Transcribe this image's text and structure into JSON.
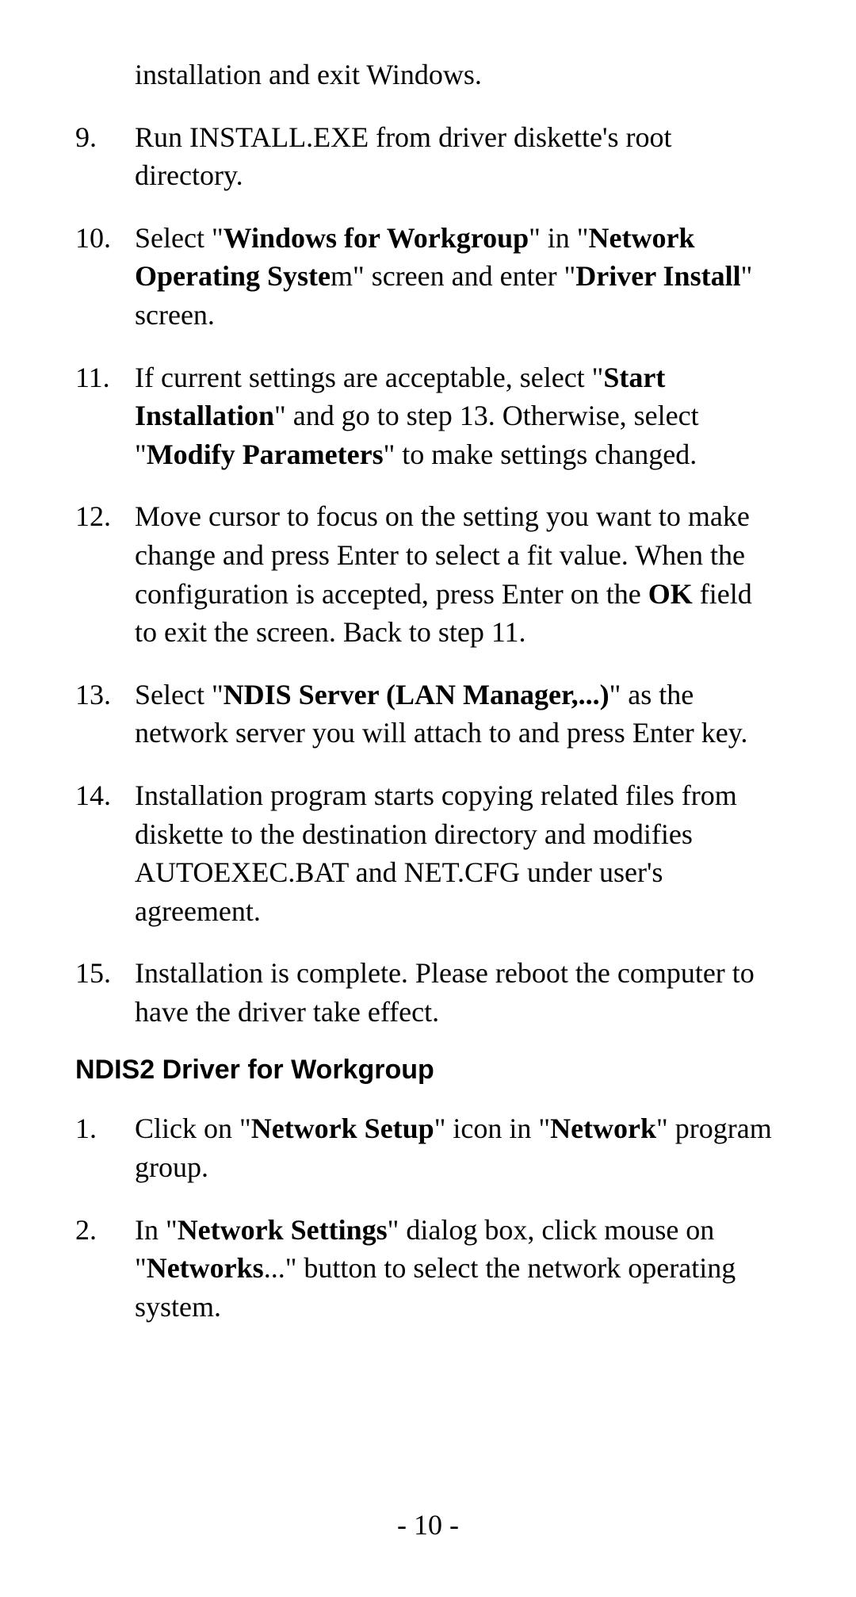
{
  "topList": {
    "start": 9,
    "continuationText": "installation and exit Windows.",
    "items": [
      {
        "num": "9.",
        "html": "Run INSTALL.EXE from driver diskette's root directory."
      },
      {
        "num": "10.",
        "html": "Select \"<b>Windows for Workgroup</b>\" in \"<b>Network Operating Syste</b>m\" screen and enter \"<b>Driver Install</b>\" screen."
      },
      {
        "num": "11.",
        "html": "If current settings are acceptable, select \"<b>Start Installation</b>\" and go to step 13. Otherwise, select \"<b>Modify Parameters</b>\" to make settings changed."
      },
      {
        "num": "12.",
        "html": "Move cursor to focus on the setting you want to make change and press Enter to select a fit value. When the configuration is accepted, press Enter on the <b>OK</b> field to exit the screen. Back to step 11."
      },
      {
        "num": "13.",
        "html": "Select \"<b>NDIS Server (LAN Manager,...)</b>\" as the network server you will attach to and press Enter key."
      },
      {
        "num": "14.",
        "html": "Installation program starts copying related files from diskette to the destination directory and modifies AUTOEXEC.BAT and NET.CFG under user's agreement."
      },
      {
        "num": "15.",
        "html": "Installation is complete.  Please reboot the computer to have the driver take effect."
      }
    ]
  },
  "sectionTitle": "NDIS2 Driver for Workgroup",
  "bottomList": {
    "items": [
      {
        "num": "1.",
        "html": "Click on \"<b>Network Setup</b>\" icon in \"<b>Network</b>\" program group."
      },
      {
        "num": "2.",
        "html": "In \"<b>Network Settings</b>\" dialog box, click mouse on \"<b>Networks</b>...\" button to select the network operating system."
      }
    ]
  },
  "pageNumber": "- 10 -"
}
